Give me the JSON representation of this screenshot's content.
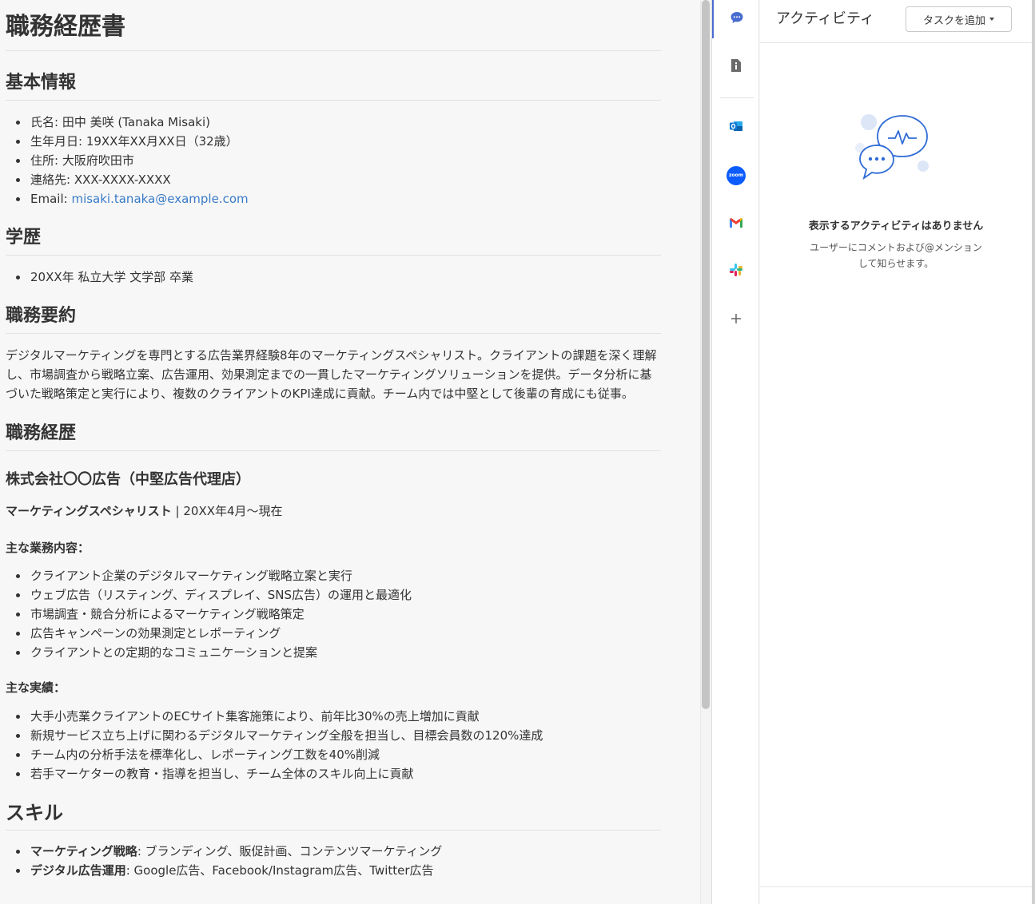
{
  "doc": {
    "title": "職務経歴書",
    "basic": {
      "heading": "基本情報",
      "items": [
        "氏名: 田中 美咲 (Tanaka Misaki)",
        "生年月日: 19XX年XX月XX日（32歳）",
        "住所: 大阪府吹田市",
        "連絡先: XXX-XXXX-XXXX"
      ],
      "email_label": "Email: ",
      "email": "misaki.tanaka@example.com"
    },
    "education": {
      "heading": "学歴",
      "items": [
        "20XX年 私立大学 文学部 卒業"
      ]
    },
    "summary": {
      "heading": "職務要約",
      "text": "デジタルマーケティングを専門とする広告業界経験8年のマーケティングスペシャリスト。クライアントの課題を深く理解し、市場調査から戦略立案、広告運用、効果測定までの一貫したマーケティングソリューションを提供。データ分析に基づいた戦略策定と実行により、複数のクライアントのKPI達成に貢献。チーム内では中堅として後輩の育成にも従事。"
    },
    "career": {
      "heading": "職務経歴",
      "company": "株式会社〇〇広告（中堅広告代理店）",
      "role": "マーケティングスペシャリスト",
      "period": " | 20XX年4月〜現在",
      "duties_heading": "主な業務内容：",
      "duties": [
        "クライアント企業のデジタルマーケティング戦略立案と実行",
        "ウェブ広告（リスティング、ディスプレイ、SNS広告）の運用と最適化",
        "市場調査・競合分析によるマーケティング戦略策定",
        "広告キャンペーンの効果測定とレポーティング",
        "クライアントとの定期的なコミュニケーションと提案"
      ],
      "achievements_heading": "主な実績：",
      "achievements": [
        "大手小売業クライアントのECサイト集客施策により、前年比30%の売上増加に貢献",
        "新規サービス立ち上げに関わるデジタルマーケティング全般を担当し、目標会員数の120%達成",
        "チーム内の分析手法を標準化し、レポーティング工数を40%削減",
        "若手マーケターの教育・指導を担当し、チーム全体のスキル向上に貢献"
      ]
    },
    "skills": {
      "heading": "スキル",
      "items": [
        {
          "label": "マーケティング戦略",
          "value": ": ブランディング、販促計画、コンテンツマーケティング"
        },
        {
          "label": "デジタル広告運用",
          "value": ": Google広告、Facebook/Instagram広告、Twitter広告"
        }
      ]
    }
  },
  "rail": {
    "items": [
      "chat-icon",
      "info-doc-icon",
      "outlook-icon",
      "zoom-icon",
      "gmail-icon",
      "slack-icon",
      "plus-icon"
    ],
    "zoom_text": "zoom"
  },
  "panel": {
    "title": "アクティビティ",
    "add_task_label": "タスクを追加",
    "empty_title": "表示するアクティビティはありません",
    "empty_desc": "ユーザーにコメントおよび@メンションして知らせます。"
  },
  "colors": {
    "accent": "#3a7bc8",
    "rail_active": "#4a6cd0",
    "illustration": "#2f6bd6"
  }
}
